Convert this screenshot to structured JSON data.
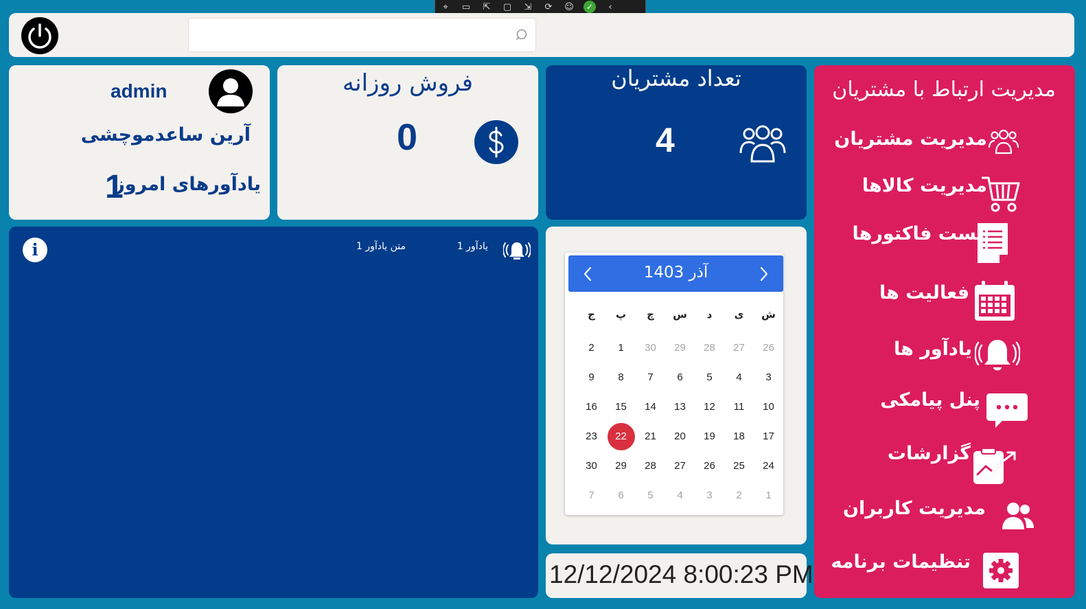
{
  "toolbar": {
    "icons": [
      "inspect-icon",
      "record-icon",
      "select-icon",
      "layout-icon",
      "pointer-icon",
      "hot-reload-icon",
      "accessibility-icon",
      "check-icon",
      "collapse-icon"
    ]
  },
  "header": {
    "search": {
      "value": "",
      "placeholder": ""
    }
  },
  "user": {
    "username": "admin",
    "full_name": "آرین ساعدموچشی",
    "reminders_label": "یادآورهای امروز",
    "reminders_count": "1"
  },
  "sales": {
    "title": "فروش روزانه",
    "value": "0"
  },
  "customers": {
    "title": "تعداد مشتریان",
    "value": "4"
  },
  "menu": {
    "title": "مدیریت ارتباط با مشتریان",
    "items": [
      {
        "label": "مدیریت مشتریان",
        "icon": "customers-icon"
      },
      {
        "label": "مدیریت کالاها",
        "icon": "cart-icon"
      },
      {
        "label": "لیست فاکتورها",
        "icon": "invoice-icon"
      },
      {
        "label": "فعالیت ها",
        "icon": "calendar-icon"
      },
      {
        "label": "یادآور ها",
        "icon": "bell-icon"
      },
      {
        "label": "پنل پیامکی",
        "icon": "chat-icon"
      },
      {
        "label": "گزارشات",
        "icon": "report-icon"
      },
      {
        "label": "مدیریت کاربران",
        "icon": "users-icon"
      },
      {
        "label": "تنظیمات برنامه",
        "icon": "gear-icon"
      }
    ]
  },
  "reminders": {
    "items": [
      {
        "title": "یادآور 1",
        "text": "متن یادآور 1"
      }
    ]
  },
  "calendar": {
    "month": "آذر 1403",
    "weekdays": [
      "ش",
      "ی",
      "د",
      "س",
      "چ",
      "پ",
      "ج"
    ],
    "weeks": [
      [
        "26",
        "27",
        "28",
        "29",
        "30",
        "1",
        "2"
      ],
      [
        "3",
        "4",
        "5",
        "6",
        "7",
        "8",
        "9"
      ],
      [
        "10",
        "11",
        "12",
        "13",
        "14",
        "15",
        "16"
      ],
      [
        "17",
        "18",
        "19",
        "20",
        "21",
        "22",
        "23"
      ],
      [
        "24",
        "25",
        "26",
        "27",
        "28",
        "29",
        "30"
      ],
      [
        "1",
        "2",
        "3",
        "4",
        "5",
        "6",
        "7"
      ]
    ],
    "today": "22"
  },
  "clock": {
    "datetime": "12/12/2024 8:00:23 PM"
  },
  "colors": {
    "background": "#0a82ae",
    "card_light": "#f3f1ee",
    "card_blue": "#033c8a",
    "card_pink": "#db1d5d",
    "calendar_header": "#2f6ee3",
    "today": "#d9303f"
  }
}
